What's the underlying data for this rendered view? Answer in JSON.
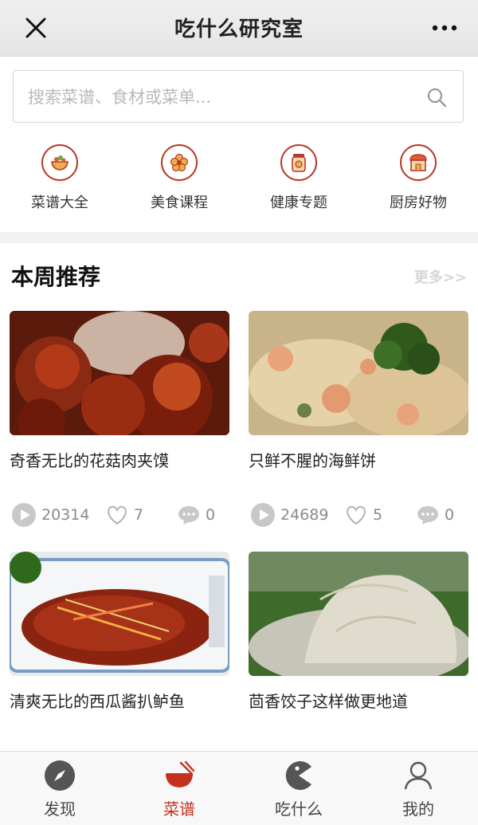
{
  "header": {
    "title": "吃什么研究室",
    "close_icon": "close-icon",
    "more_icon": "more-icon"
  },
  "search": {
    "placeholder": "搜索菜谱、食材或菜单...",
    "value": "",
    "icon": "search-icon"
  },
  "categories": [
    {
      "label": "菜谱大全",
      "icon": "recipe-bowl-icon"
    },
    {
      "label": "美食课程",
      "icon": "flower-icon"
    },
    {
      "label": "健康专题",
      "icon": "jar-icon"
    },
    {
      "label": "厨房好物",
      "icon": "shop-icon"
    }
  ],
  "weekly": {
    "title": "本周推荐",
    "more_label": "更多>>",
    "items": [
      {
        "title": "奇香无比的花菇肉夹馍",
        "plays": "20314",
        "likes": "7",
        "comments": "0"
      },
      {
        "title": "只鲜不腥的海鲜饼",
        "plays": "24689",
        "likes": "5",
        "comments": "0"
      },
      {
        "title": "清爽无比的西瓜酱扒鲈鱼",
        "plays": "",
        "likes": "",
        "comments": ""
      },
      {
        "title": "茴香饺子这样做更地道",
        "plays": "",
        "likes": "",
        "comments": ""
      }
    ]
  },
  "tabbar": {
    "active": "菜谱",
    "accent_color": "#c5311f",
    "tabs": [
      {
        "label": "发现",
        "icon": "compass-icon"
      },
      {
        "label": "菜谱",
        "icon": "bowl-chopsticks-icon"
      },
      {
        "label": "吃什么",
        "icon": "pacman-icon"
      },
      {
        "label": "我的",
        "icon": "user-icon"
      }
    ]
  }
}
